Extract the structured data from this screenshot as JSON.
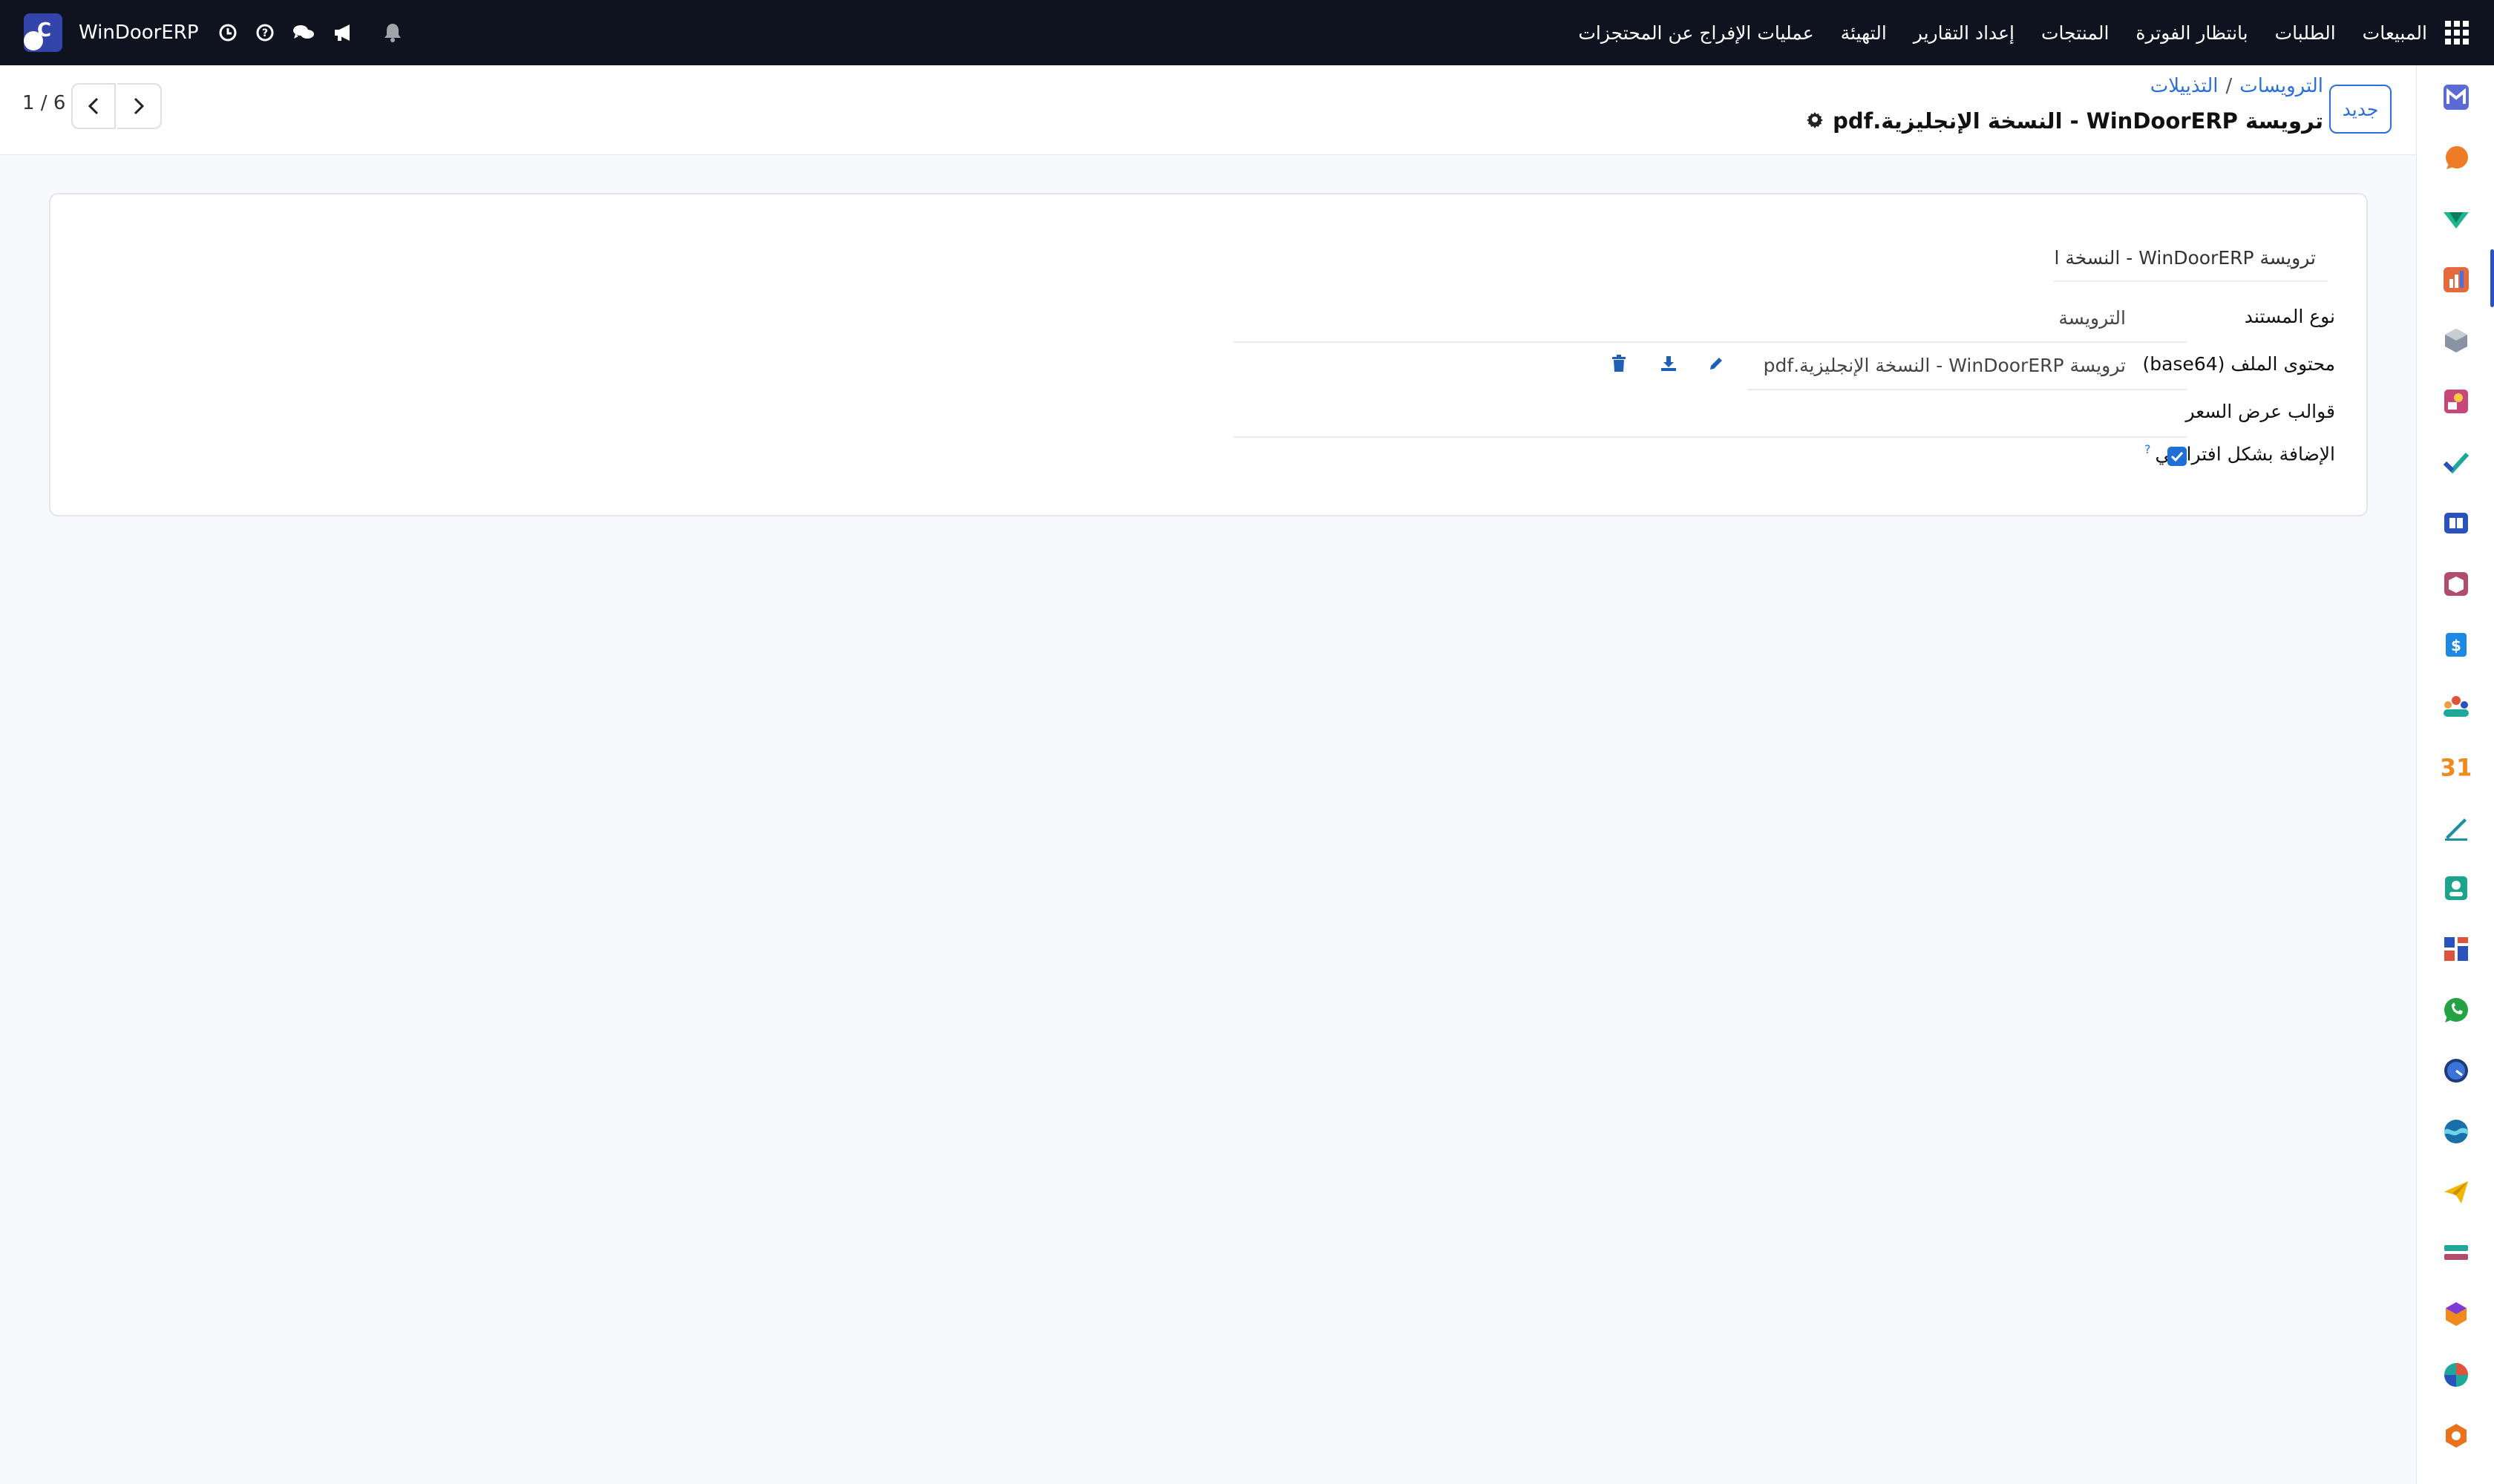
{
  "navbar": {
    "menu": [
      "المبيعات",
      "الطلبات",
      "بانتظار الفوترة",
      "المنتجات",
      "إعداد التقارير",
      "التهيئة",
      "عمليات الإفراج عن المحتجزات"
    ],
    "company_name": "WinDoorERP",
    "avatar_letter": "C",
    "icons": [
      "apps-grid-icon",
      "bell-icon",
      "megaphone-icon",
      "chat-icon",
      "help-icon",
      "clock-icon"
    ]
  },
  "control_panel": {
    "new_button": "جديد",
    "breadcrumb": [
      "الترويسات",
      "التذييلات"
    ],
    "breadcrumb_separator": "/",
    "record_title": "ترويسة WinDoorERP - النسخة الإنجليزية.pdf",
    "pager": "1 / 6"
  },
  "form": {
    "name_value": "ترويسة WinDoorERP - النسخة الإن",
    "fields": {
      "doc_type": {
        "label": "نوع المستند",
        "value": "الترويسة"
      },
      "file_content": {
        "label": "محتوى الملف (base64)",
        "value": "ترويسة WinDoorERP - النسخة الإنجليزية.pdf"
      },
      "quote_templates": {
        "label": "قوالب عرض السعر",
        "value": ""
      },
      "add_by_default": {
        "label": "الإضافة بشكل افتراضي",
        "help": "?",
        "checked": true
      }
    }
  },
  "sidebar_apps": {
    "calendar_day": "31",
    "icons": [
      "gmail-icon",
      "chat-bubble-icon",
      "check-diamond-icon",
      "bar-chart-icon",
      "cube-icon",
      "image-icon",
      "checkmark-icon",
      "book-icon",
      "box-icon",
      "dollar-doc-icon",
      "people-icon",
      "calendar-icon",
      "pen-icon",
      "contact-card-icon",
      "dashboard-icon",
      "whatsapp-icon",
      "clock-app-icon",
      "wave-icon",
      "send-icon",
      "layers-icon",
      "hexagon-icon",
      "pie-icon",
      "gear-hex-icon"
    ]
  },
  "colors": {
    "navbar_bg": "#0f1320",
    "accent": "#2a6fdb",
    "page_bg": "#f8f9fc"
  }
}
